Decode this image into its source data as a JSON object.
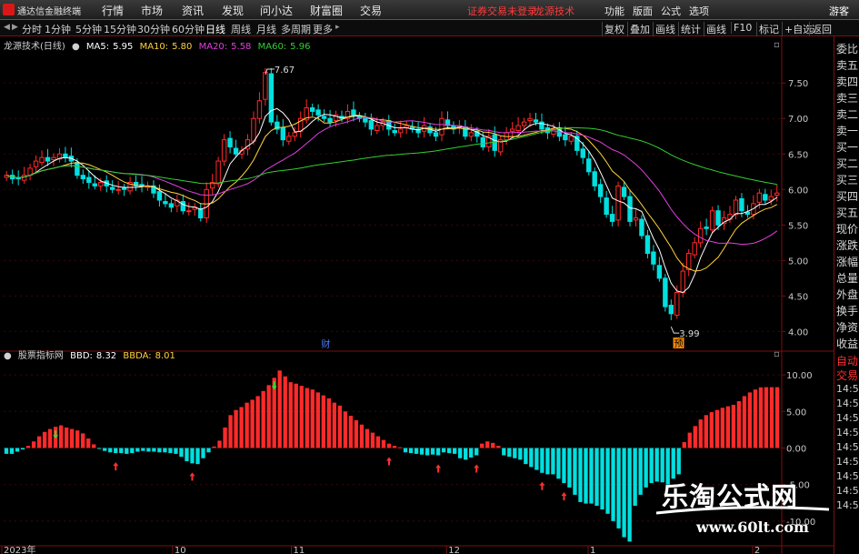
{
  "app": {
    "title": "通达信金融终端"
  },
  "menu": [
    "行情",
    "市场",
    "资讯",
    "发现",
    "问小达",
    "财富圈",
    "交易"
  ],
  "login_status": "证券交易未登录",
  "right_menu": [
    "龙源技术",
    "功能",
    "版面",
    "公式",
    "选项",
    "游客"
  ],
  "periods": [
    "分时",
    "1分钟",
    "5分钟",
    "15分钟",
    "30分钟",
    "60分钟",
    "日线",
    "周线",
    "月线",
    "多周期",
    "更多"
  ],
  "active_period": "日线",
  "tools": [
    "复权",
    "叠加",
    "画线",
    "统计",
    "画线",
    "F10",
    "标记",
    "+自选",
    "返回"
  ],
  "stock": {
    "name": "龙源技术(日线)"
  },
  "ma": [
    {
      "label": "MA5:",
      "value": "5.95",
      "color": "#ffffff"
    },
    {
      "label": "MA10:",
      "value": "5.80",
      "color": "#ffd23c"
    },
    {
      "label": "MA20:",
      "value": "5.58",
      "color": "#e040e0"
    },
    {
      "label": "MA60:",
      "value": "5.96",
      "color": "#30d030"
    }
  ],
  "indicator": {
    "name": "股票指标网",
    "items": [
      {
        "label": "BBD:",
        "value": "8.32",
        "color": "#ffffff"
      },
      {
        "label": "BBDA:",
        "value": "8.01",
        "color": "#ffd23c"
      }
    ]
  },
  "markers": {
    "fin": "财",
    "other": "预"
  },
  "sidebar": {
    "items": [
      "委比",
      "卖五",
      "卖四",
      "卖三",
      "卖二",
      "卖一",
      "买一",
      "买二",
      "买三",
      "买四",
      "买五",
      "现价",
      "涨跌",
      "涨幅",
      "总量",
      "外盘",
      "换手",
      "净资",
      "收益"
    ],
    "bottom_items": [
      "自动",
      "交易"
    ],
    "times": [
      "14:55",
      "14:55",
      "14:55",
      "14:56",
      "14:56",
      "14:56",
      "14:56",
      "14:56",
      "14:56"
    ]
  },
  "watermark": {
    "title": "乐淘公式网",
    "url": "www.60lt.com"
  },
  "colors": {
    "up": "#ff2a2a",
    "down": "#00e0e0",
    "grid": "#7a1010",
    "axis_text": "#c8c8c8"
  },
  "chart_data": [
    {
      "type": "candlestick",
      "title": "龙源技术(日线)",
      "ylim": [
        3.8,
        7.9
      ],
      "y_ticks": [
        4.0,
        4.5,
        5.0,
        5.5,
        6.0,
        6.5,
        7.0,
        7.5
      ],
      "y_tick_labels": [
        "4.00",
        "4.50",
        "5.00",
        "5.50",
        "6.00",
        "6.50",
        "7.00",
        "7.50"
      ],
      "x_ticks": [
        "2023年",
        "10",
        "11",
        "12",
        "1",
        "2"
      ],
      "annotations": [
        {
          "text": "7.67",
          "value": 7.67
        },
        {
          "text": "3.99",
          "value": 3.99
        }
      ],
      "close": [
        6.2,
        6.15,
        6.15,
        6.2,
        6.3,
        6.4,
        6.45,
        6.4,
        6.45,
        6.5,
        6.45,
        6.4,
        6.2,
        6.15,
        6.1,
        6.05,
        6.1,
        6.05,
        6.0,
        6.0,
        6.0,
        6.1,
        6.05,
        6.05,
        6.05,
        5.95,
        5.85,
        5.8,
        5.75,
        5.85,
        5.7,
        5.7,
        5.75,
        5.6,
        6.0,
        6.1,
        6.4,
        6.7,
        6.6,
        6.5,
        6.55,
        6.7,
        7.0,
        7.25,
        7.65,
        6.95,
        6.85,
        6.7,
        6.75,
        6.8,
        7.0,
        7.15,
        7.1,
        7.05,
        7.0,
        6.95,
        7.05,
        7.0,
        7.1,
        7.05,
        7.0,
        6.95,
        6.85,
        6.9,
        6.95,
        6.85,
        6.8,
        6.85,
        6.9,
        6.85,
        6.8,
        6.9,
        6.8,
        6.75,
        7.0,
        6.9,
        6.85,
        6.9,
        6.75,
        6.8,
        6.75,
        6.6,
        6.75,
        6.55,
        6.7,
        6.8,
        6.85,
        6.9,
        6.95,
        7.0,
        6.95,
        6.85,
        6.8,
        6.85,
        6.75,
        6.7,
        6.75,
        6.55,
        6.45,
        6.25,
        6.05,
        5.9,
        5.65,
        5.55,
        6.05,
        5.9,
        5.55,
        5.6,
        5.35,
        5.1,
        4.95,
        4.75,
        4.35,
        4.25,
        4.55,
        4.85,
        5.1,
        5.25,
        5.45,
        5.45,
        5.7,
        5.5,
        5.6,
        5.65,
        5.85,
        5.7,
        5.65,
        5.8,
        5.95,
        5.85,
        5.9,
        5.95
      ],
      "ma_series": [
        "MA5",
        "MA10",
        "MA20",
        "MA60"
      ]
    },
    {
      "type": "bar",
      "title": "股票指标网",
      "ylim": [
        -14.5,
        13.0
      ],
      "y_ticks": [
        10.0,
        5.0,
        0.0,
        -5.0,
        -10.0
      ],
      "y_tick_labels": [
        "10.00",
        "5.00",
        "0.00",
        "-5.00",
        "-10.00"
      ],
      "series": [
        {
          "name": "BBD",
          "values": [
            -0.8,
            -0.8,
            -0.5,
            -0.2,
            0.3,
            0.9,
            1.6,
            2.2,
            2.6,
            2.9,
            3.1,
            2.8,
            2.6,
            2.4,
            2.0,
            1.3,
            0.5,
            -0.1,
            -0.4,
            -0.6,
            -0.7,
            -0.7,
            -0.8,
            -0.7,
            -0.5,
            -0.4,
            -0.5,
            -0.5,
            -0.6,
            -0.6,
            -0.7,
            -0.8,
            -1.2,
            -1.8,
            -2.1,
            -2.2,
            -1.4,
            -0.6,
            0.2,
            1.0,
            2.8,
            4.5,
            5.2,
            5.6,
            6.2,
            6.6,
            7.1,
            7.8,
            8.6,
            9.6,
            10.6,
            9.8,
            9.0,
            8.8,
            8.5,
            8.2,
            8.0,
            7.6,
            7.2,
            6.8,
            6.2,
            5.8,
            5.0,
            4.4,
            3.8,
            3.2,
            2.6,
            2.1,
            1.6,
            1.1,
            0.6,
            0.3,
            0.1,
            -0.6,
            -0.7,
            -0.8,
            -0.9,
            -1.0,
            -0.9,
            -1.0,
            -0.6,
            -0.7,
            -0.8,
            -1.4,
            -1.6,
            -1.3,
            -1.0,
            0.6,
            0.9,
            0.7,
            0.3,
            -1.0,
            -1.2,
            -1.4,
            -1.6,
            -2.2,
            -2.6,
            -3.0,
            -3.4,
            -3.6,
            -3.6,
            -4.2,
            -4.8,
            -5.4,
            -6.4,
            -7.4,
            -7.6,
            -7.6,
            -7.9,
            -8.4,
            -9.0,
            -10.0,
            -11.0,
            -12.2,
            -12.8,
            -7.9,
            -6.4,
            -5.4,
            -4.8,
            -4.6,
            -4.7,
            -5.0,
            -4.2,
            -3.6,
            0.8,
            2.1,
            3.0,
            3.9,
            4.5,
            4.9,
            5.2,
            5.5,
            5.7,
            5.9,
            6.4,
            7.1,
            7.6,
            8.0,
            8.3,
            8.32,
            8.32,
            8.32
          ]
        }
      ],
      "signals_up": [
        20,
        34,
        70,
        79,
        86,
        98,
        102
      ],
      "signals_down": [
        9,
        49
      ]
    }
  ]
}
